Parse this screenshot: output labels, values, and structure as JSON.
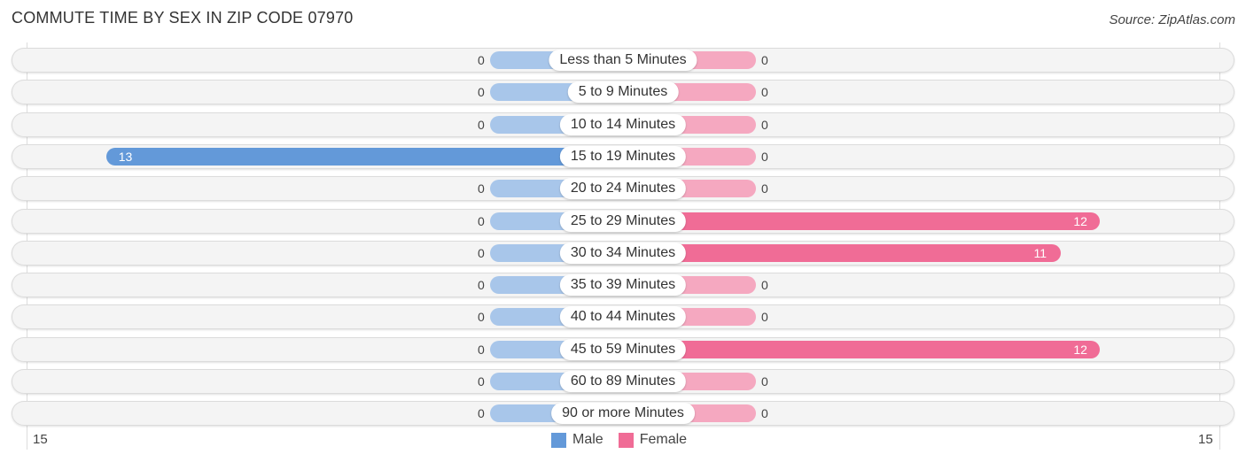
{
  "title": "COMMUTE TIME BY SEX IN ZIP CODE 07970",
  "source": "Source: ZipAtlas.com",
  "colors": {
    "male": "#6399d9",
    "female": "#f06c96",
    "male_stub": "#a8c6ea",
    "female_stub": "#f5a8c0"
  },
  "chart_data": {
    "type": "bar",
    "orientation": "horizontal-diverging",
    "title": "COMMUTE TIME BY SEX IN ZIP CODE 07970",
    "categories": [
      "Less than 5 Minutes",
      "5 to 9 Minutes",
      "10 to 14 Minutes",
      "15 to 19 Minutes",
      "20 to 24 Minutes",
      "25 to 29 Minutes",
      "30 to 34 Minutes",
      "35 to 39 Minutes",
      "40 to 44 Minutes",
      "45 to 59 Minutes",
      "60 to 89 Minutes",
      "90 or more Minutes"
    ],
    "series": [
      {
        "name": "Male",
        "values": [
          0,
          0,
          0,
          13,
          0,
          0,
          0,
          0,
          0,
          0,
          0,
          0
        ]
      },
      {
        "name": "Female",
        "values": [
          0,
          0,
          0,
          0,
          0,
          12,
          11,
          0,
          0,
          12,
          0,
          0
        ]
      }
    ],
    "axis": {
      "left_tick": "15",
      "right_tick": "15",
      "range": [
        -15,
        15
      ]
    },
    "legend": {
      "position": "bottom-center",
      "entries": [
        "Male",
        "Female"
      ]
    },
    "grid": false
  }
}
